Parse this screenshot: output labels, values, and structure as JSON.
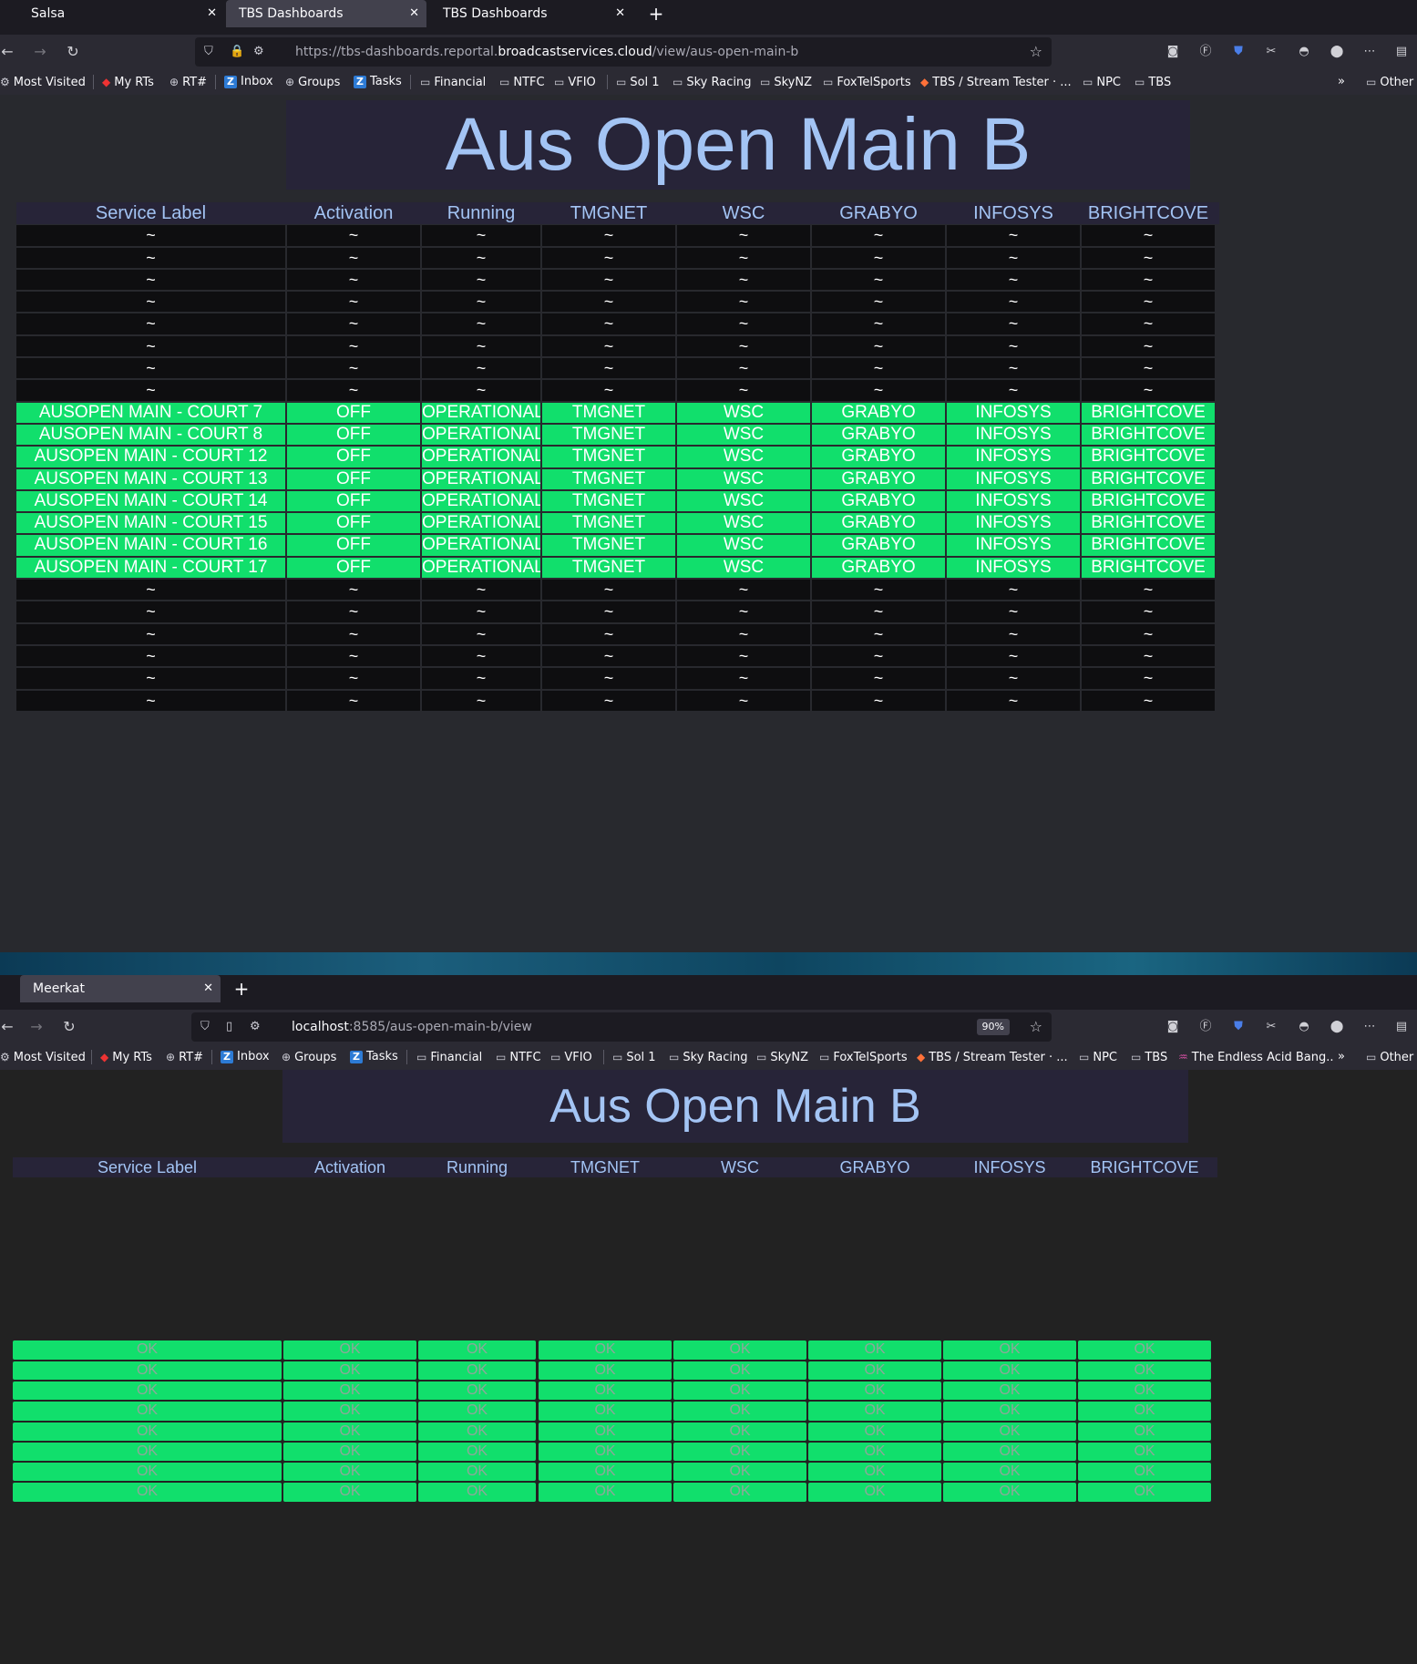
{
  "window1": {
    "tabs": [
      {
        "label": "Salsa",
        "active": false
      },
      {
        "label": "TBS Dashboards",
        "active": true
      },
      {
        "label": "TBS Dashboards",
        "active": false
      }
    ],
    "url": {
      "prefix": "https://tbs-dashboards.reportal.",
      "domain": "broadcastservices.cloud",
      "path": "/view/aus-open-main-b"
    },
    "bookmarks": [
      "Most Visited",
      "My RTs",
      "RT#",
      "Inbox",
      "Groups",
      "Tasks",
      "Financial",
      "NTFC",
      "VFIO",
      "Sol 1",
      "Sky Racing",
      "SkyNZ",
      "FoxTelSports",
      "TBS / Stream Tester · ...",
      "NPC",
      "TBS"
    ],
    "other_bookmarks": "Other",
    "page": {
      "title": "Aus Open Main B",
      "columns": [
        "Service Label",
        "Activation",
        "Running",
        "TMGNET",
        "WSC",
        "GRABYO",
        "INFOSYS",
        "BRIGHTCOVE"
      ],
      "empty_marker": "~",
      "rows_before": 8,
      "active_rows": [
        [
          "AUSOPEN MAIN - COURT 7",
          "OFF",
          "OPERATIONAL",
          "TMGNET",
          "WSC",
          "GRABYO",
          "INFOSYS",
          "BRIGHTCOVE"
        ],
        [
          "AUSOPEN MAIN - COURT 8",
          "OFF",
          "OPERATIONAL",
          "TMGNET",
          "WSC",
          "GRABYO",
          "INFOSYS",
          "BRIGHTCOVE"
        ],
        [
          "AUSOPEN MAIN - COURT 12",
          "OFF",
          "OPERATIONAL",
          "TMGNET",
          "WSC",
          "GRABYO",
          "INFOSYS",
          "BRIGHTCOVE"
        ],
        [
          "AUSOPEN MAIN - COURT 13",
          "OFF",
          "OPERATIONAL",
          "TMGNET",
          "WSC",
          "GRABYO",
          "INFOSYS",
          "BRIGHTCOVE"
        ],
        [
          "AUSOPEN MAIN - COURT 14",
          "OFF",
          "OPERATIONAL",
          "TMGNET",
          "WSC",
          "GRABYO",
          "INFOSYS",
          "BRIGHTCOVE"
        ],
        [
          "AUSOPEN MAIN - COURT 15",
          "OFF",
          "OPERATIONAL",
          "TMGNET",
          "WSC",
          "GRABYO",
          "INFOSYS",
          "BRIGHTCOVE"
        ],
        [
          "AUSOPEN MAIN - COURT 16",
          "OFF",
          "OPERATIONAL",
          "TMGNET",
          "WSC",
          "GRABYO",
          "INFOSYS",
          "BRIGHTCOVE"
        ],
        [
          "AUSOPEN MAIN - COURT 17",
          "OFF",
          "OPERATIONAL",
          "TMGNET",
          "WSC",
          "GRABYO",
          "INFOSYS",
          "BRIGHTCOVE"
        ]
      ],
      "rows_after": 6
    }
  },
  "window2": {
    "tabs": [
      {
        "label": "Meerkat",
        "active": true
      }
    ],
    "url": {
      "domain": "localhost",
      "path": ":8585/aus-open-main-b/view"
    },
    "zoom": "90%",
    "bookmarks": [
      "Most Visited",
      "My RTs",
      "RT#",
      "Inbox",
      "Groups",
      "Tasks",
      "Financial",
      "NTFC",
      "VFIO",
      "Sol 1",
      "Sky Racing",
      "SkyNZ",
      "FoxTelSports",
      "TBS / Stream Tester · ...",
      "NPC",
      "TBS",
      "The Endless Acid Bang..."
    ],
    "other_bookmarks": "Other",
    "page": {
      "title": "Aus Open Main B",
      "columns": [
        "Service Label",
        "Activation",
        "Running",
        "TMGNET",
        "WSC",
        "GRABYO",
        "INFOSYS",
        "BRIGHTCOVE"
      ],
      "blank_rows": 8,
      "ok_text": "OK",
      "ok_rows": 8
    }
  },
  "colors": {
    "ok_green": "#11df6c",
    "title_blue": "#a3c4f4",
    "empty_cell": "#0e0e10"
  }
}
